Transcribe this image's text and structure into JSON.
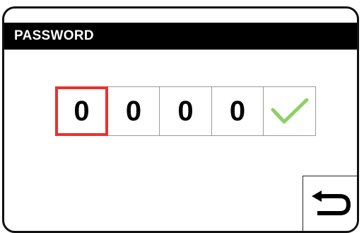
{
  "title": "PASSWORD",
  "pin": {
    "digits": [
      "0",
      "0",
      "0",
      "0"
    ],
    "selected_index": 0,
    "confirm_icon": "checkmark-icon",
    "confirm_color": "#8fcf6a"
  },
  "selection_color": "#e8322e",
  "back": {
    "icon": "return-arrow-icon"
  }
}
